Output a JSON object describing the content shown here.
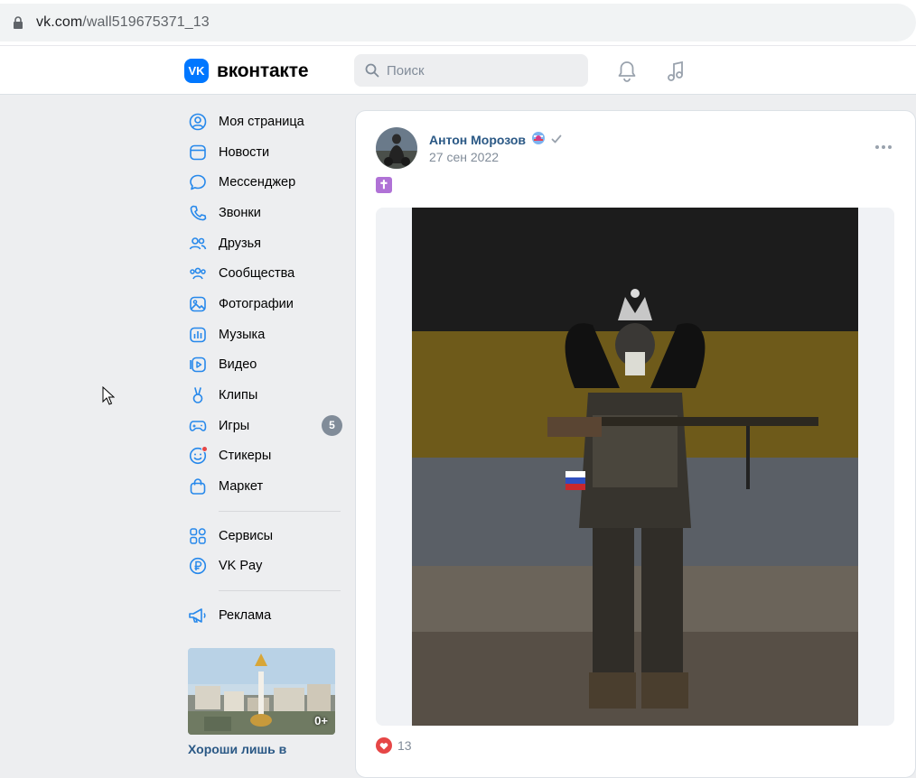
{
  "browser": {
    "url_host": "vk.com",
    "url_path": "/wall519675371_13"
  },
  "header": {
    "logo_text": "вконтакте",
    "logo_mark": "VK",
    "search_placeholder": "Поиск"
  },
  "nav": {
    "items": [
      {
        "label": "Моя страница",
        "icon": "user-circle-icon"
      },
      {
        "label": "Новости",
        "icon": "news-icon"
      },
      {
        "label": "Мессенджер",
        "icon": "message-icon"
      },
      {
        "label": "Звонки",
        "icon": "phone-icon"
      },
      {
        "label": "Друзья",
        "icon": "friends-icon"
      },
      {
        "label": "Сообщества",
        "icon": "communities-icon"
      },
      {
        "label": "Фотографии",
        "icon": "photo-icon"
      },
      {
        "label": "Музыка",
        "icon": "music-icon"
      },
      {
        "label": "Видео",
        "icon": "video-icon"
      },
      {
        "label": "Клипы",
        "icon": "clips-icon"
      },
      {
        "label": "Игры",
        "icon": "gamepad-icon",
        "badge": "5"
      },
      {
        "label": "Стикеры",
        "icon": "sticker-icon"
      },
      {
        "label": "Маркет",
        "icon": "market-bag-icon"
      }
    ],
    "items2": [
      {
        "label": "Сервисы",
        "icon": "services-icon"
      },
      {
        "label": "VK Pay",
        "icon": "vkpay-icon"
      }
    ],
    "items3": [
      {
        "label": "Реклама",
        "icon": "megaphone-icon"
      }
    ]
  },
  "promo": {
    "age": "0+",
    "title": "Хороши лишь в"
  },
  "post": {
    "author": "Антон Морозов",
    "date": "27 сен 2022",
    "text_emoji": "✝",
    "likes": "13"
  },
  "colors": {
    "accent": "#0077ff",
    "link": "#2a5885",
    "badge": "#818c99",
    "like": "#e64646"
  }
}
